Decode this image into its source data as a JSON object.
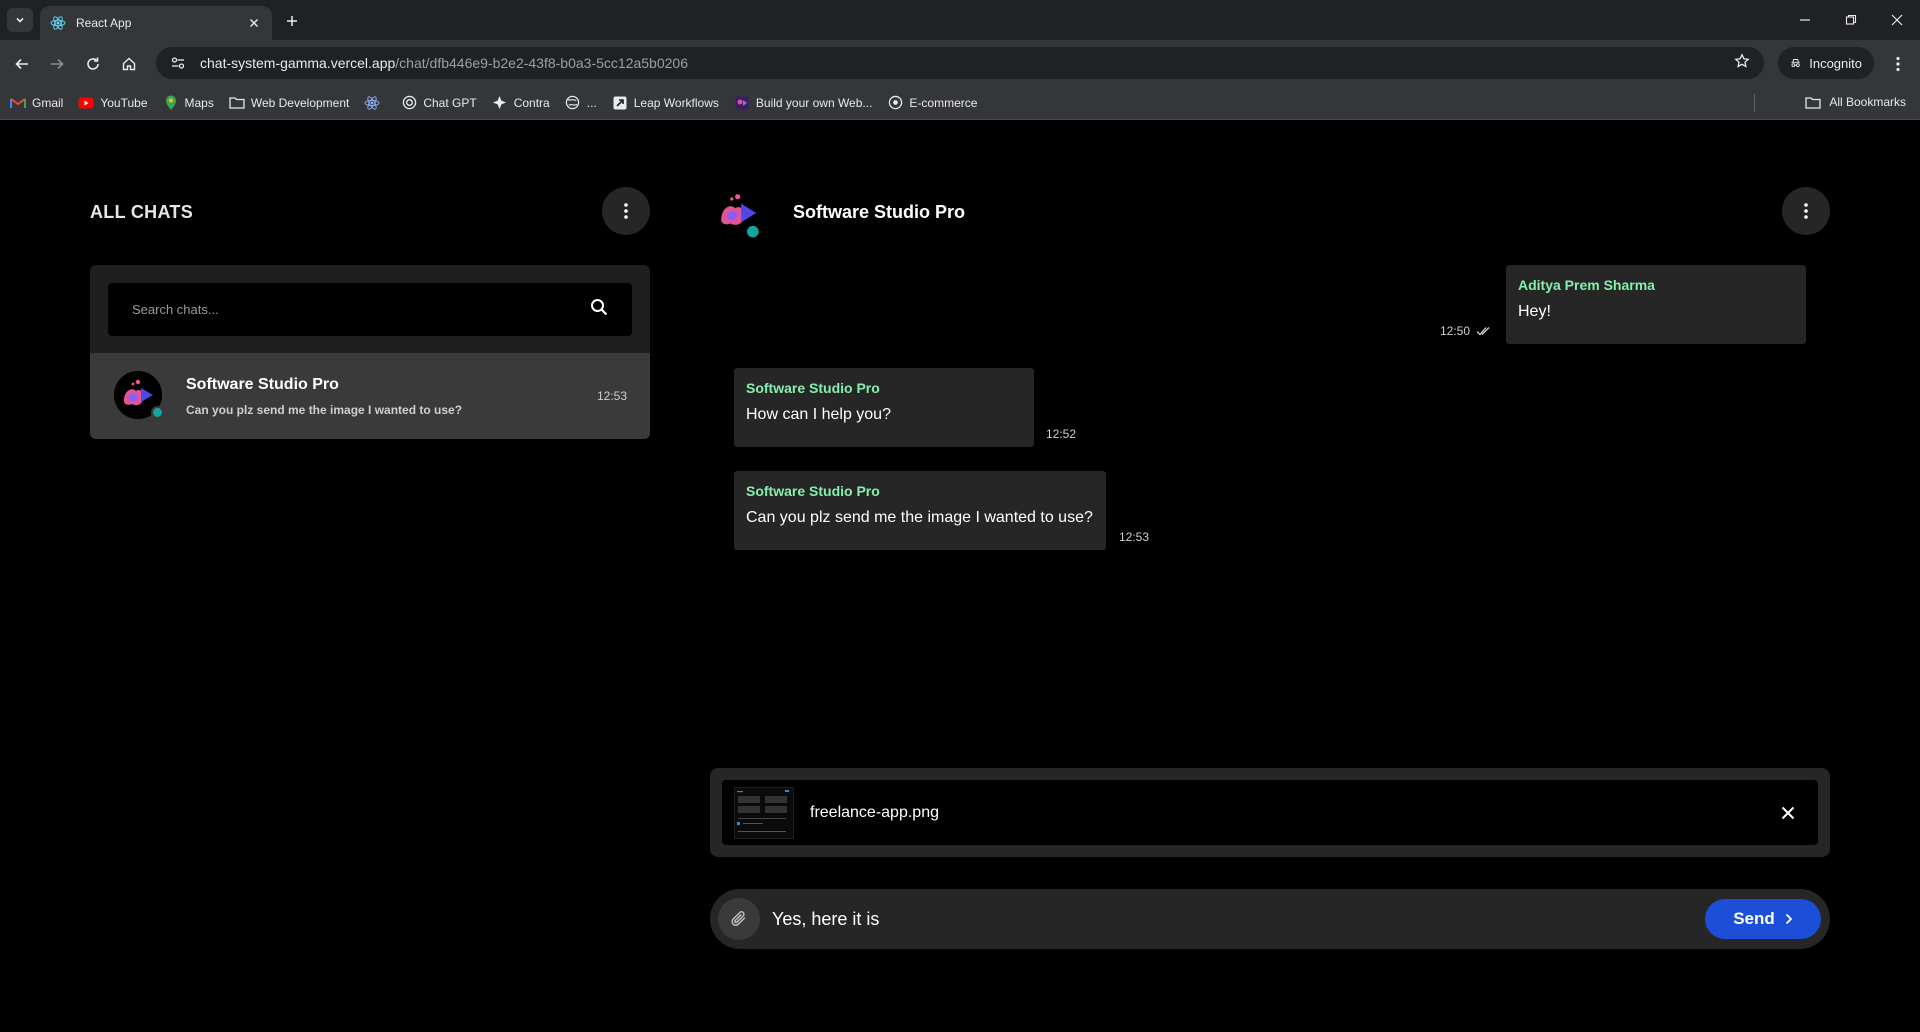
{
  "browser": {
    "tab_title": "React App",
    "url_host": "chat-system-gamma.vercel.app",
    "url_path": "/chat/dfb446e9-b2e2-43f8-b0a3-5cc12a5b0206",
    "incognito_label": "Incognito",
    "bookmarks": [
      {
        "label": "Gmail",
        "icon": "gmail-icon"
      },
      {
        "label": "YouTube",
        "icon": "youtube-icon"
      },
      {
        "label": "Maps",
        "icon": "maps-icon"
      },
      {
        "label": "Web Development",
        "icon": "folder-icon"
      },
      {
        "label": "",
        "icon": "react-icon"
      },
      {
        "label": "Chat GPT",
        "icon": "openai-icon"
      },
      {
        "label": "Contra",
        "icon": "contra-icon"
      },
      {
        "label": "...",
        "icon": "globe-icon"
      },
      {
        "label": "Leap Workflows",
        "icon": "leap-icon"
      },
      {
        "label": "Build your own Web...",
        "icon": "build-icon"
      },
      {
        "label": "E-commerce",
        "icon": "ecommerce-icon"
      }
    ],
    "all_bookmarks_label": "All Bookmarks"
  },
  "sidebar": {
    "title": "ALL CHATS",
    "search_placeholder": "Search chats...",
    "chats": [
      {
        "name": "Software Studio Pro",
        "preview": "Can you plz send me the image I wanted to use?",
        "time": "12:53"
      }
    ]
  },
  "conversation": {
    "title": "Software Studio Pro",
    "messages": [
      {
        "sender": "Aditya Prem Sharma",
        "text": "Hey!",
        "time": "12:50",
        "outgoing": true
      },
      {
        "sender": "Software Studio Pro",
        "text": "How can I help you?",
        "time": "12:52",
        "outgoing": false
      },
      {
        "sender": "Software Studio Pro",
        "text": "Can you plz send me the image I wanted to use?",
        "time": "12:53",
        "outgoing": false
      }
    ]
  },
  "composer": {
    "attachment_name": "freelance-app.png",
    "input_value": "Yes, here it is",
    "send_label": "Send"
  },
  "colors": {
    "accent": "#1d4ed8",
    "sender_name": "#86efac",
    "online": "#13a5a0"
  }
}
